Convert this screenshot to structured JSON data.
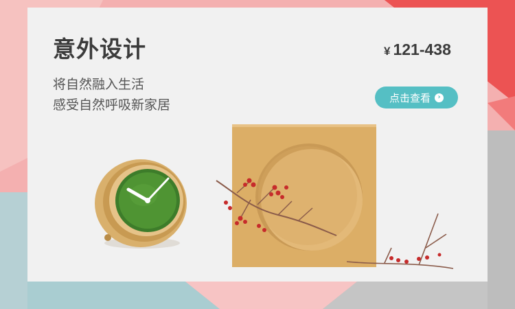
{
  "banner": {
    "title": "意外设计",
    "price_symbol": "¥",
    "price_range": "121-438",
    "subtitle_line1": "将自然融入生活",
    "subtitle_line2": "感受自然呼吸新家居",
    "cta_label": "点击查看",
    "cta_icon": "chevron-right-icon"
  },
  "colors": {
    "card_bg": "#f1f1f1",
    "accent": "#55bfc4",
    "text_dark": "#3b3b3b"
  }
}
